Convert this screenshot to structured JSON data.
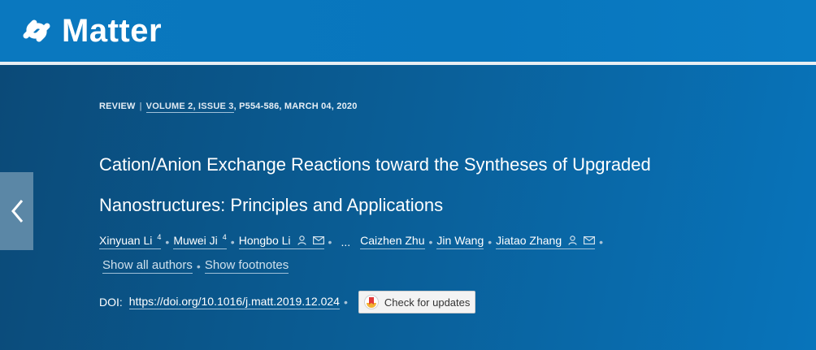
{
  "header": {
    "brand": "Matter"
  },
  "article": {
    "type": "REVIEW",
    "separator": "|",
    "volume_issue": "VOLUME 2, ISSUE 3",
    "pages_date": ", P554-586, MARCH 04, 2020",
    "title_line1": "Cation/Anion Exchange Reactions toward the Syntheses of Upgraded",
    "title_line2": "Nanostructures: Principles and Applications",
    "authors": [
      {
        "name": "Xinyuan Li",
        "sup": "4"
      },
      {
        "name": "Muwei Ji",
        "sup": "4"
      },
      {
        "name": "Hongbo Li",
        "icons": [
          "person-icon",
          "mail-icon"
        ]
      },
      {
        "name": "Caizhen Zhu"
      },
      {
        "name": "Jin Wang"
      },
      {
        "name": "Jiatao Zhang",
        "icons": [
          "person-icon",
          "mail-icon"
        ]
      }
    ],
    "ellipsis": "...",
    "show_all_authors": "Show all authors",
    "show_footnotes": "Show footnotes",
    "doi_label": "DOI:",
    "doi_link": "https://doi.org/10.1016/j.matt.2019.12.024",
    "check_updates": "Check for updates"
  },
  "colors": {
    "brand_blue": "#0876bd",
    "hero_dark": "#0b4a78",
    "arrow_bg": "#5b87a6"
  }
}
